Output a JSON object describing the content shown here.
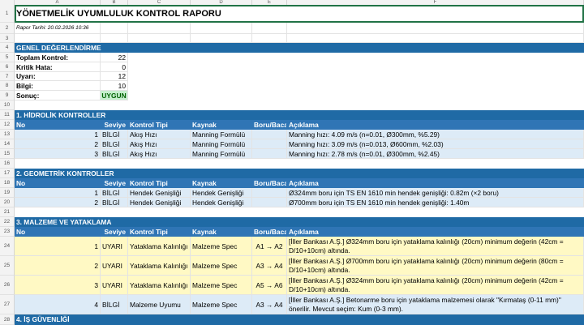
{
  "columns": [
    "A",
    "B",
    "C",
    "D",
    "E",
    "F"
  ],
  "row_numbers": [
    "1",
    "2",
    "3",
    "4",
    "5",
    "6",
    "7",
    "8",
    "9",
    "10",
    "11",
    "12",
    "13",
    "14",
    "15",
    "16",
    "17",
    "18",
    "19",
    "20",
    "21",
    "22",
    "23",
    "24",
    "25",
    "26",
    "27",
    "28"
  ],
  "title": "YÖNETMELİK UYUMLULUK KONTROL RAPORU",
  "report_date": "Rapor Tarihi: 20.02.2026 10:36",
  "general": {
    "header": "GENEL DEĞERLENDİRME",
    "rows": [
      {
        "label": "Toplam Kontrol:",
        "value": "22"
      },
      {
        "label": "Kritik Hata:",
        "value": "0"
      },
      {
        "label": "Uyarı:",
        "value": "12"
      },
      {
        "label": "Bilgi:",
        "value": "10"
      }
    ],
    "result_label": "Sonuç:",
    "result_value": "UYGUN"
  },
  "table_headers": {
    "no": "No",
    "seviye": "Seviye",
    "tip": "Kontrol Tipi",
    "kaynak": "Kaynak",
    "boru": "Boru/Baca",
    "aciklama": "Açıklama"
  },
  "sections": [
    {
      "title": "1. HİDROLİK KONTROLLER",
      "items": [
        {
          "no": "1",
          "seviye": "BİLGİ",
          "tip": "Akış Hızı",
          "kaynak": "Manning Formülü",
          "boru": "",
          "aciklama": "Manning hızı: 4.09 m/s (n=0.01, Ø300mm, %5.29)"
        },
        {
          "no": "2",
          "seviye": "BİLGİ",
          "tip": "Akış Hızı",
          "kaynak": "Manning Formülü",
          "boru": "",
          "aciklama": "Manning hızı: 3.09 m/s (n=0.013, Ø600mm, %2.03)"
        },
        {
          "no": "3",
          "seviye": "BİLGİ",
          "tip": "Akış Hızı",
          "kaynak": "Manning Formülü",
          "boru": "",
          "aciklama": "Manning hızı: 2.78 m/s (n=0.01, Ø300mm, %2.45)"
        }
      ]
    },
    {
      "title": "2. GEOMETRİK KONTROLLER",
      "items": [
        {
          "no": "1",
          "seviye": "BİLGİ",
          "tip": "Hendek Genişliği",
          "kaynak": "Hendek Genişliği",
          "boru": "",
          "aciklama": "Ø324mm boru için TS EN 1610 min hendek genişliği: 0.82m (×2 boru)"
        },
        {
          "no": "2",
          "seviye": "BİLGİ",
          "tip": "Hendek Genişliği",
          "kaynak": "Hendek Genişliği",
          "boru": "",
          "aciklama": "Ø700mm boru için TS EN 1610 min hendek genişliği: 1.40m"
        }
      ]
    },
    {
      "title": "3. MALZEME VE YATAKLAMA",
      "items": [
        {
          "no": "1",
          "seviye": "UYARI",
          "tip": "Yataklama Kalınlığı",
          "kaynak": "Malzeme Spec",
          "boru": "A1 → A2",
          "aciklama": "[İller Bankası A.Ş.] Ø324mm boru için yataklama kalınlığı (20cm) minimum değerin (42cm = D/10+10cm) altında."
        },
        {
          "no": "2",
          "seviye": "UYARI",
          "tip": "Yataklama Kalınlığı",
          "kaynak": "Malzeme Spec",
          "boru": "A3 → A4",
          "aciklama": "[İller Bankası A.Ş.] Ø700mm boru için yataklama kalınlığı (20cm) minimum değerin (80cm = D/10+10cm) altında."
        },
        {
          "no": "3",
          "seviye": "UYARI",
          "tip": "Yataklama Kalınlığı",
          "kaynak": "Malzeme Spec",
          "boru": "A5 → A6",
          "aciklama": "[İller Bankası A.Ş.] Ø324mm boru için yataklama kalınlığı (20cm) minimum değerin (42cm = D/10+10cm) altında."
        },
        {
          "no": "4",
          "seviye": "BİLGİ",
          "tip": "Malzeme Uyumu",
          "kaynak": "Malzeme Spec",
          "boru": "A3 → A4",
          "aciklama": "[İller Bankası A.Ş.] Betonarme boru için yataklama malzemesi olarak \"Kırmataş (0-11 mm)\" önerilir. Mevcut seçim: Kum (0-3 mm)."
        }
      ]
    },
    {
      "title": "4. İŞ GÜVENLİĞİ"
    }
  ]
}
